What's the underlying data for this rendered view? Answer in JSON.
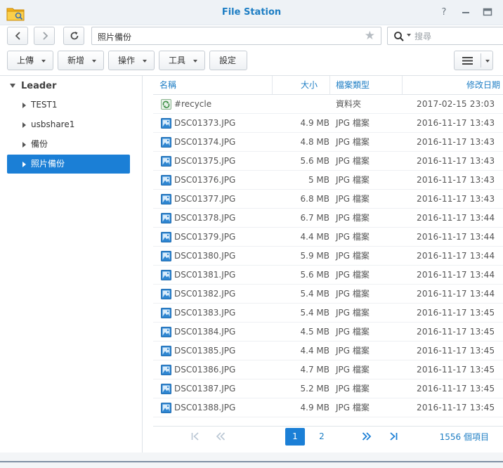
{
  "window": {
    "title": "File Station"
  },
  "nav": {
    "path": "照片備份",
    "search_placeholder": "搜尋"
  },
  "toolbar": {
    "upload": "上傳",
    "create": "新增",
    "action": "操作",
    "tools": "工具",
    "settings": "設定"
  },
  "sidebar": {
    "root": "Leader",
    "items": [
      {
        "label": "TEST1",
        "selected": false
      },
      {
        "label": "usbshare1",
        "selected": false
      },
      {
        "label": "備份",
        "selected": false
      },
      {
        "label": "照片備份",
        "selected": true
      }
    ]
  },
  "grid": {
    "columns": {
      "name": "名稱",
      "size": "大小",
      "type": "檔案類型",
      "modified": "修改日期"
    },
    "rows": [
      {
        "icon": "recycle-icon",
        "name": "#recycle",
        "size": "",
        "type": "資料夾",
        "modified": "2017-02-15 23:03"
      },
      {
        "icon": "image-icon",
        "name": "DSC01373.JPG",
        "size": "4.9 MB",
        "type": "JPG 檔案",
        "modified": "2016-11-17 13:43"
      },
      {
        "icon": "image-icon",
        "name": "DSC01374.JPG",
        "size": "4.8 MB",
        "type": "JPG 檔案",
        "modified": "2016-11-17 13:43"
      },
      {
        "icon": "image-icon",
        "name": "DSC01375.JPG",
        "size": "5.6 MB",
        "type": "JPG 檔案",
        "modified": "2016-11-17 13:43"
      },
      {
        "icon": "image-icon",
        "name": "DSC01376.JPG",
        "size": "5 MB",
        "type": "JPG 檔案",
        "modified": "2016-11-17 13:43"
      },
      {
        "icon": "image-icon",
        "name": "DSC01377.JPG",
        "size": "6.8 MB",
        "type": "JPG 檔案",
        "modified": "2016-11-17 13:43"
      },
      {
        "icon": "image-icon",
        "name": "DSC01378.JPG",
        "size": "6.7 MB",
        "type": "JPG 檔案",
        "modified": "2016-11-17 13:44"
      },
      {
        "icon": "image-icon",
        "name": "DSC01379.JPG",
        "size": "4.4 MB",
        "type": "JPG 檔案",
        "modified": "2016-11-17 13:44"
      },
      {
        "icon": "image-icon",
        "name": "DSC01380.JPG",
        "size": "5.9 MB",
        "type": "JPG 檔案",
        "modified": "2016-11-17 13:44"
      },
      {
        "icon": "image-icon",
        "name": "DSC01381.JPG",
        "size": "5.6 MB",
        "type": "JPG 檔案",
        "modified": "2016-11-17 13:44"
      },
      {
        "icon": "image-icon",
        "name": "DSC01382.JPG",
        "size": "5.4 MB",
        "type": "JPG 檔案",
        "modified": "2016-11-17 13:44"
      },
      {
        "icon": "image-icon",
        "name": "DSC01383.JPG",
        "size": "5.4 MB",
        "type": "JPG 檔案",
        "modified": "2016-11-17 13:45"
      },
      {
        "icon": "image-icon",
        "name": "DSC01384.JPG",
        "size": "4.5 MB",
        "type": "JPG 檔案",
        "modified": "2016-11-17 13:45"
      },
      {
        "icon": "image-icon",
        "name": "DSC01385.JPG",
        "size": "4.4 MB",
        "type": "JPG 檔案",
        "modified": "2016-11-17 13:45"
      },
      {
        "icon": "image-icon",
        "name": "DSC01386.JPG",
        "size": "4.7 MB",
        "type": "JPG 檔案",
        "modified": "2016-11-17 13:45"
      },
      {
        "icon": "image-icon",
        "name": "DSC01387.JPG",
        "size": "5.2 MB",
        "type": "JPG 檔案",
        "modified": "2016-11-17 13:45"
      },
      {
        "icon": "image-icon",
        "name": "DSC01388.JPG",
        "size": "4.9 MB",
        "type": "JPG 檔案",
        "modified": "2016-11-17 13:45"
      }
    ]
  },
  "pager": {
    "pages": [
      "1",
      "2"
    ],
    "current": "1",
    "total": "1556 個項目"
  },
  "colors": {
    "accent": "#1b7fd6",
    "header_text": "#1e7ec4",
    "title_bar": "#eef2f6"
  }
}
